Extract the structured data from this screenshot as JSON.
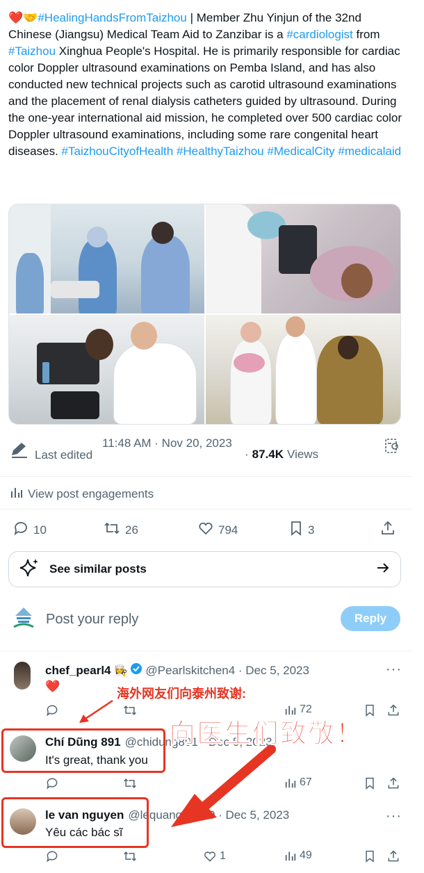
{
  "post": {
    "emoji_heart": "❤️",
    "emoji_hands": "🤝",
    "tag1": "#HealingHandsFromTaizhou",
    "text1": " | Member Zhu Yinjun of the 32nd Chinese (Jiangsu) Medical Team Aid to Zanzibar is a ",
    "tag2": "#cardiologist",
    "text2": " from ",
    "tag3": "#Taizhou",
    "text3": " Xinghua People's Hospital. He is primarily responsible for cardiac color Doppler ultrasound examinations on Pemba Island, and has also conducted new technical projects such as carotid ultrasound examinations and the placement of renal dialysis catheters guided by ultrasound. During the one-year international aid mission, he completed over 500 cardiac color Doppler ultrasound examinations, including some rare congenital heart diseases. ",
    "tag4": "#TaizhouCityofHealth",
    "tag5": "#HealthyTaizhou",
    "tag6": "#MedicalCity",
    "tag7": "#medicalaid"
  },
  "meta": {
    "last_edited": "Last edited",
    "timestamp": "11:48 AM · Nov 20, 2023",
    "views_prefix": "·",
    "views_count": "87.4K",
    "views_label": "Views",
    "engagements": "View post engagements"
  },
  "actions": {
    "replies": "10",
    "reposts": "26",
    "likes": "794",
    "bookmarks": "3"
  },
  "similar": {
    "label": "See similar posts"
  },
  "composer": {
    "placeholder": "Post your reply",
    "reply_label": "Reply"
  },
  "replies": [
    {
      "name": "chef_pearl4",
      "name_emoji": "👩‍🍳",
      "handle": "@Pearlskitchen4 · Dec 5, 2023",
      "body": "❤️",
      "views": "72"
    },
    {
      "name": "Chí Dũng 891",
      "handle": "@chidung891 · Dec 5, 2023",
      "body": "It's great, thank you",
      "views": "67"
    },
    {
      "name": "le van nguyen",
      "handle": "@lequang20689 · Dec 5, 2023",
      "body": "Yêu các bác sĩ",
      "likes": "1",
      "views": "49"
    }
  ],
  "annotations": {
    "small": "海外网友们向泰州致谢:",
    "big": "向医生们致敬！"
  },
  "colors": {
    "accent": "#1d9bf0",
    "annotation_red": "#e63523",
    "reply_button": "#8ecdf7",
    "muted": "#536471"
  }
}
